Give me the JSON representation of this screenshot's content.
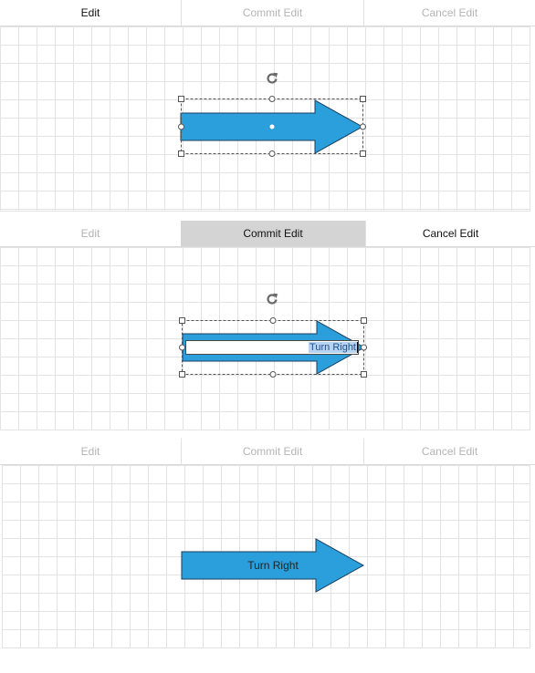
{
  "panels": [
    {
      "state": "selected",
      "toolbar": {
        "edit": "Edit",
        "commit": "Commit Edit",
        "cancel": "Cancel Edit"
      }
    },
    {
      "state": "editing",
      "toolbar": {
        "edit": "Edit",
        "commit": "Commit Edit",
        "cancel": "Cancel Edit"
      },
      "editor_text": "Turn Right"
    },
    {
      "state": "committed",
      "toolbar": {
        "edit": "Edit",
        "commit": "Commit Edit",
        "cancel": "Cancel Edit"
      },
      "shape_label": "Turn Right"
    }
  ],
  "colors": {
    "arrow_fill": "#2a9fdc",
    "arrow_stroke": "#1a3d5c",
    "grid_line": "#e3e3e3",
    "selection_dash": "#555555",
    "disabled_text": "#b4b4b4",
    "pressed_bg": "#d4d4d4",
    "selection_highlight": "#b6d4f2"
  },
  "icons": {
    "rotate": "rotate-icon"
  }
}
